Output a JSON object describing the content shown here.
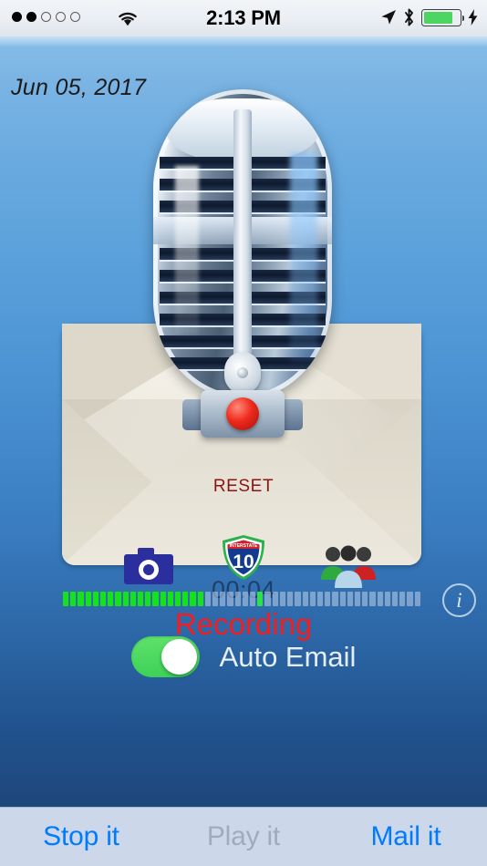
{
  "status_bar": {
    "signal_dots": [
      "filled",
      "filled",
      "empty",
      "empty",
      "empty"
    ],
    "wifi_icon": "wifi-icon",
    "time": "2:13 PM",
    "location_icon": "location-arrow-icon",
    "bluetooth_icon": "bluetooth-icon",
    "battery_icon": "battery-icon",
    "battery_level_percent": 82,
    "charging_icon": "lightning-bolt-icon",
    "battery_color": "#4cd561"
  },
  "main": {
    "date_label": "Jun 05, 2017",
    "artwork": {
      "microphone_icon": "retro-microphone-icon",
      "envelope_icon": "envelope-icon",
      "record_button_icon": "record-dot-icon"
    },
    "reset_label": "RESET",
    "icon_row": {
      "camera_icon": "camera-icon",
      "highway_shield": {
        "icon": "interstate-shield-icon",
        "banner_text": "INTERSTATE",
        "route_number": "10"
      },
      "people_icon": "group-of-people-icon"
    },
    "timer": "00:04",
    "level_meter": {
      "total_segments": 48,
      "lit_segments": 19,
      "peak_segment_index": 26,
      "lit_color": "#15e21a",
      "unlit_color": "#aec4de"
    },
    "info_button_label": "i",
    "recording_status": "Recording",
    "recording_status_color": "#f41d1d",
    "auto_email": {
      "label": "Auto Email",
      "state": "on",
      "on_color": "#4cd561"
    }
  },
  "toolbar": {
    "buttons": [
      {
        "label": "Stop it",
        "state": "enabled"
      },
      {
        "label": "Play it",
        "state": "disabled"
      },
      {
        "label": "Mail it",
        "state": "enabled"
      }
    ],
    "enabled_color": "#007aff",
    "disabled_color": "#a0abbb"
  }
}
